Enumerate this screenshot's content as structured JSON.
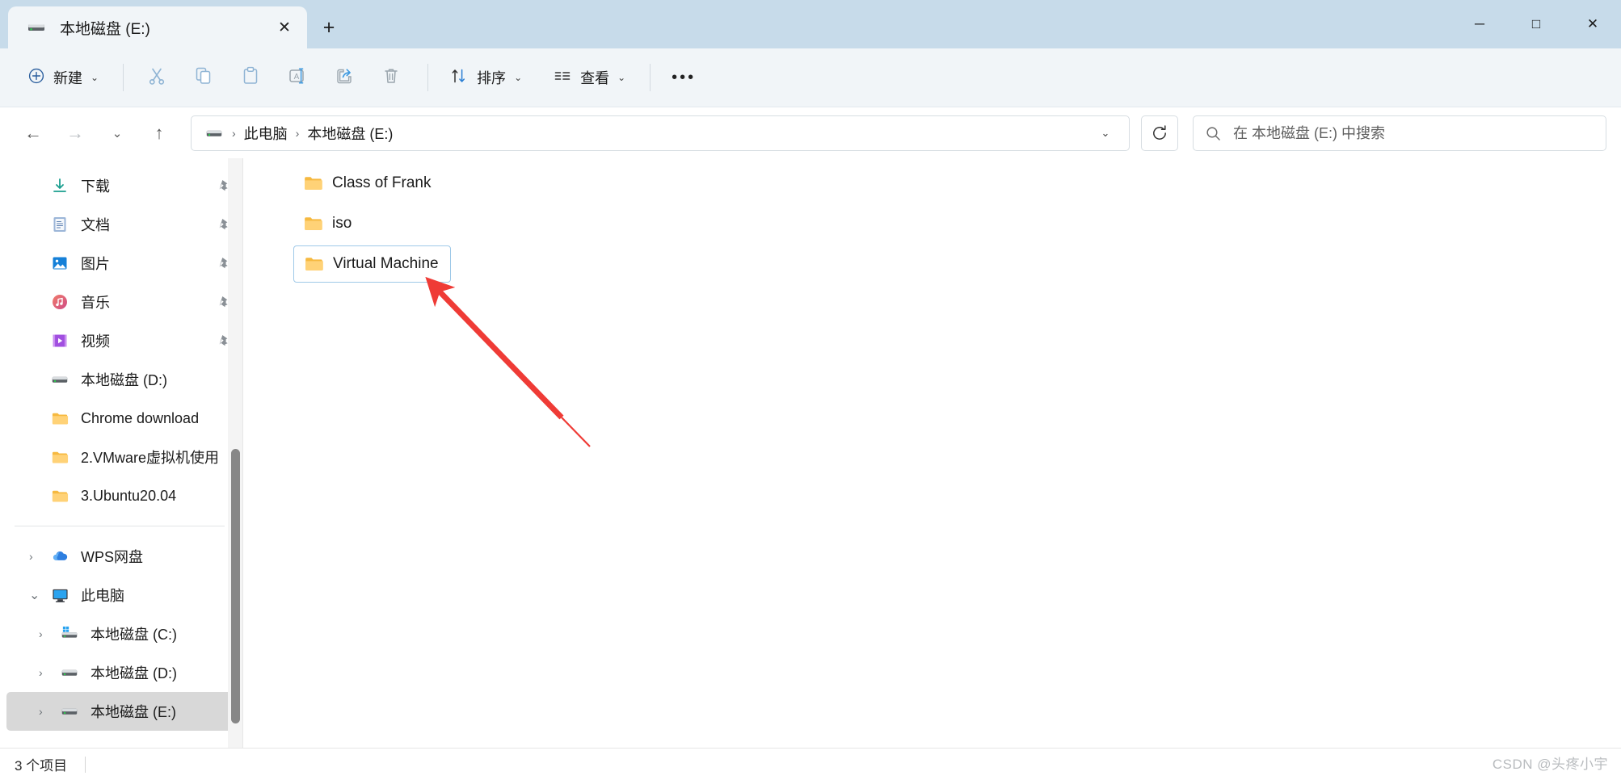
{
  "window": {
    "controls": [
      {
        "name": "minimize",
        "glyph": "─"
      },
      {
        "name": "maximize",
        "glyph": "□"
      },
      {
        "name": "close",
        "glyph": "✕"
      }
    ]
  },
  "tab": {
    "title": "本地磁盘 (E:)",
    "icon": "drive-icon",
    "close_glyph": "✕",
    "newtab_glyph": "+"
  },
  "toolbar": {
    "new_label": "新建",
    "new_caret": "⌄",
    "cut_label": "cut-icon",
    "copy_label": "copy-icon",
    "paste_label": "paste-icon",
    "rename_label": "rename-icon",
    "share_label": "share-icon",
    "delete_label": "delete-icon",
    "sort_label": "排序",
    "sort_caret": "⌄",
    "view_label": "查看",
    "view_caret": "⌄",
    "overflow_label": "•••"
  },
  "navigation": {
    "back_glyph": "←",
    "forward_glyph": "→",
    "recent_glyph": "⌄",
    "up_glyph": "↑",
    "refresh_glyph": "↻"
  },
  "breadcrumb": {
    "icon": "drive-icon",
    "sep": "›",
    "items": [
      {
        "label": "此电脑"
      },
      {
        "label": "本地磁盘 (E:)"
      }
    ],
    "dropdown_glyph": "⌄"
  },
  "search": {
    "icon": "search-icon",
    "placeholder": "在 本地磁盘 (E:) 中搜索",
    "value": ""
  },
  "sidebar": {
    "quick_access": [
      {
        "label": "下载",
        "icon": "download-icon",
        "pinned": true
      },
      {
        "label": "文档",
        "icon": "documents-icon",
        "pinned": true
      },
      {
        "label": "图片",
        "icon": "pictures-icon",
        "pinned": true
      },
      {
        "label": "音乐",
        "icon": "music-icon",
        "pinned": true
      },
      {
        "label": "视频",
        "icon": "videos-icon",
        "pinned": true
      },
      {
        "label": "本地磁盘 (D:)",
        "icon": "drive-icon",
        "pinned": false
      },
      {
        "label": "Chrome download",
        "icon": "folder-icon",
        "pinned": false
      },
      {
        "label": "2.VMware虚拟机使用",
        "icon": "folder-icon",
        "pinned": false
      },
      {
        "label": "3.Ubuntu20.04",
        "icon": "folder-icon",
        "pinned": false
      }
    ],
    "tree": [
      {
        "label": "WPS网盘",
        "icon": "cloud-icon",
        "chevron": "›",
        "expanded": false,
        "indent": 0,
        "selected": false
      },
      {
        "label": "此电脑",
        "icon": "pc-icon",
        "chevron": "⌄",
        "expanded": true,
        "indent": 0,
        "selected": false
      },
      {
        "label": "本地磁盘 (C:)",
        "icon": "windows-drive-icon",
        "chevron": "›",
        "expanded": false,
        "indent": 1,
        "selected": false
      },
      {
        "label": "本地磁盘 (D:)",
        "icon": "drive-icon",
        "chevron": "›",
        "expanded": false,
        "indent": 1,
        "selected": false
      },
      {
        "label": "本地磁盘 (E:)",
        "icon": "drive-icon",
        "chevron": "›",
        "expanded": false,
        "indent": 1,
        "selected": true
      }
    ]
  },
  "files": [
    {
      "name": "Class of Frank",
      "icon": "folder-icon",
      "focused": false
    },
    {
      "name": "iso",
      "icon": "folder-icon",
      "focused": false
    },
    {
      "name": "Virtual Machine",
      "icon": "folder-icon",
      "focused": true
    }
  ],
  "status": {
    "count": "3 个项目"
  },
  "watermark": {
    "text": "CSDN @头疼小宇"
  },
  "annotation": {
    "type": "arrow",
    "color": "#ef3b36",
    "target": "Virtual Machine"
  },
  "colors": {
    "titlebar": "#c7dbea",
    "toolbar": "#f1f5f8",
    "selection": "#d8d8d8",
    "focus_border": "#9fc9e8",
    "folder": "#ffc84d",
    "annotation_red": "#ef3b36"
  }
}
